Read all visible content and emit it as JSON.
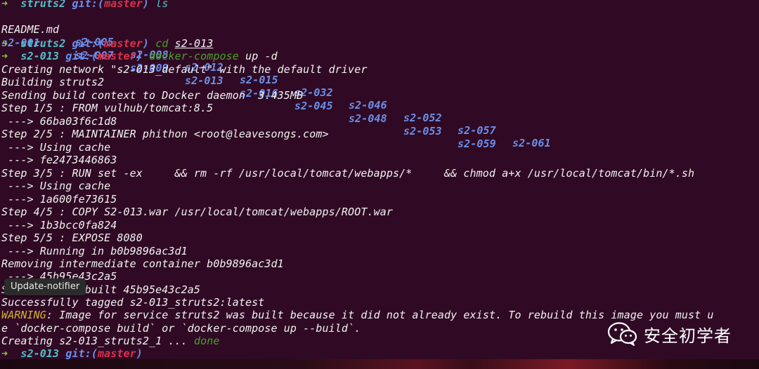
{
  "prompt": {
    "arrow": "➜",
    "git": "git:(",
    "branch": "master",
    "close": ")"
  },
  "l1": {
    "dir": "struts2",
    "cmd": "ls"
  },
  "ls": {
    "row1": [
      "README.md",
      "s2-005",
      "s2-008",
      "s2-012",
      "s2-015",
      "s2-032",
      "s2-046",
      "s2-052",
      "s2-057",
      "s2-061"
    ],
    "row2": [
      "s2-001",
      "s2-007",
      "s2-009",
      "s2-013",
      "s2-016",
      "s2-045",
      "s2-048",
      "s2-053",
      "s2-059"
    ]
  },
  "l4": {
    "dir": "struts2",
    "cmd": "cd",
    "arg": "s2-013"
  },
  "l5": {
    "dir": "s2-013",
    "cmd": "docker-compose",
    "args": "up -d"
  },
  "output": [
    "Creating network \"s2-013_default\" with the default driver",
    "Building struts2",
    "Sending build context to Docker daemon  3.435MB",
    "Step 1/5 : FROM vulhub/tomcat:8.5",
    " ---> 66ba03f6c1d8",
    "Step 2/5 : MAINTAINER phithon <root@leavesongs.com>",
    " ---> Using cache",
    " ---> fe2473446863",
    "Step 3/5 : RUN set -ex     && rm -rf /usr/local/tomcat/webapps/*     && chmod a+x /usr/local/tomcat/bin/*.sh",
    " ---> Using cache",
    " ---> 1a600fe73615",
    "Step 4/5 : COPY S2-013.war /usr/local/tomcat/webapps/ROOT.war",
    " ---> 1b3bcc0fa824",
    "Step 5/5 : EXPOSE 8080",
    " ---> Running in b0b9896ac3d1",
    "Removing intermediate container b0b9896ac3d1",
    " ---> 45b95e43c2a5",
    "Successfully built 45b95e43c2a5",
    "Successfully tagged s2-013_struts2:latest"
  ],
  "warning": {
    "label": "WARNING",
    "text": ": Image for service struts2 was built because it did not already exist. To rebuild this image you must u",
    "cont": "e `docker-compose build` or `docker-compose up --build`."
  },
  "creating": {
    "text": "Creating s2-013_struts2_1 ... ",
    "status": "done"
  },
  "last": {
    "dir": "s2-013"
  },
  "tooltip": "Update-notifier",
  "watermark": "安全初学者",
  "colors": {
    "background": "#300a24",
    "prompt_arrow": "#7fd13a",
    "dir": "#4fc1c8",
    "branch": "#e0314a",
    "git": "#6b8fe8",
    "warning": "#d4b13a",
    "done": "#4a9f2a"
  }
}
